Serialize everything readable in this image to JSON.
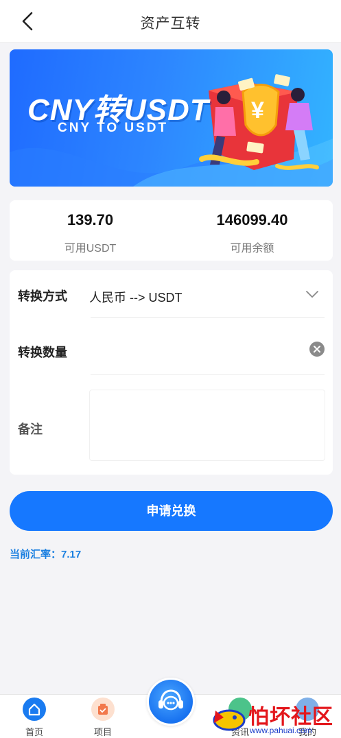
{
  "header": {
    "title": "资产互转"
  },
  "banner": {
    "title": "CNY转USDT",
    "subtitle": "CNY TO USDT"
  },
  "balances": [
    {
      "value": "139.70",
      "label": "可用USDT"
    },
    {
      "value": "146099.40",
      "label": "可用余额"
    }
  ],
  "form": {
    "mode_label": "转换方式",
    "mode_value": "人民币 --> USDT",
    "amount_label": "转换数量",
    "amount_value": "",
    "note_label": "备注",
    "note_value": ""
  },
  "submit_label": "申请兑换",
  "rate": {
    "label": "当前汇率：",
    "value": "7.17"
  },
  "tabbar": [
    {
      "label": "首页",
      "icon": "home-icon"
    },
    {
      "label": "项目",
      "icon": "project-icon"
    },
    {
      "label": "",
      "icon": "customer-service-icon"
    },
    {
      "label": "资讯",
      "icon": "news-icon"
    },
    {
      "label": "我的",
      "icon": "profile-icon"
    }
  ],
  "watermark": {
    "text": "怕坏社区",
    "url": "www.pahuai.com"
  },
  "colors": {
    "accent": "#1678ff",
    "rate_text": "#1a7fe0",
    "watermark_red": "#e3161b"
  }
}
